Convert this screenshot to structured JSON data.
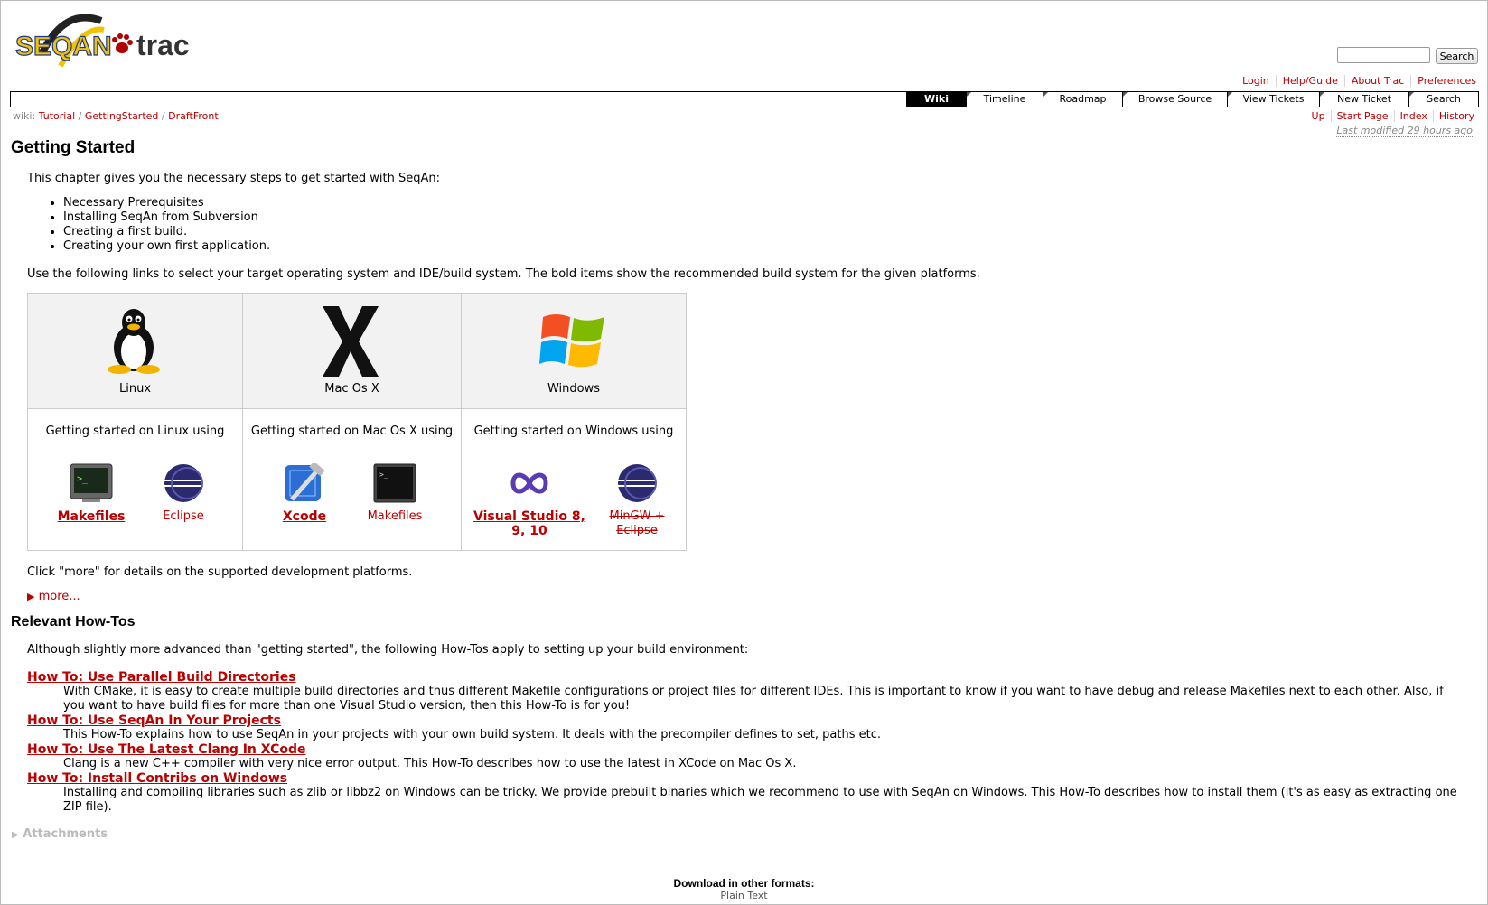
{
  "logo": {
    "text_left": "SEQAN",
    "text_right": "trac"
  },
  "search": {
    "placeholder": "",
    "button": "Search"
  },
  "metanav": [
    "Login",
    "Help/Guide",
    "About Trac",
    "Preferences"
  ],
  "mainnav": [
    {
      "label": "Wiki",
      "active": true
    },
    {
      "label": "Timeline"
    },
    {
      "label": "Roadmap"
    },
    {
      "label": "Browse Source"
    },
    {
      "label": "View Tickets"
    },
    {
      "label": "New Ticket"
    },
    {
      "label": "Search"
    }
  ],
  "pagepath": {
    "prefix": "wiki:",
    "crumbs": [
      "Tutorial",
      "GettingStarted",
      "DraftFront"
    ]
  },
  "ctxtnav": [
    "Up",
    "Start Page",
    "Index",
    "History"
  ],
  "last_modified": {
    "prefix": "Last modified ",
    "age": "29 hours ago"
  },
  "content": {
    "title": "Getting Started",
    "intro": "This chapter gives you the necessary steps to get started with SeqAn:",
    "bullets": [
      "Necessary Prerequisites",
      "Installing SeqAn from Subversion",
      "Creating a first build.",
      "Creating your own first application."
    ],
    "select_text": "Use the following links to select your target operating system and IDE/build system. The bold items show the recommended build system for the given platforms.",
    "platforms": [
      {
        "name": "Linux",
        "using": "Getting started on Linux using",
        "tools": [
          {
            "label": "Makefiles",
            "bold": true,
            "icon": "terminal-icon"
          },
          {
            "label": "Eclipse",
            "icon": "eclipse-icon"
          }
        ]
      },
      {
        "name": "Mac Os X",
        "using": "Getting started on Mac Os X using",
        "tools": [
          {
            "label": "Xcode",
            "bold": true,
            "icon": "xcode-icon"
          },
          {
            "label": "Makefiles",
            "icon": "terminal-icon"
          }
        ]
      },
      {
        "name": "Windows",
        "using": "Getting started on Windows using",
        "tools": [
          {
            "label": "Visual Studio 8, 9, 10",
            "bold": true,
            "icon": "visual-studio-icon"
          },
          {
            "label": "MinGW + Eclipse",
            "strike": true,
            "icon": "eclipse-icon"
          }
        ]
      }
    ],
    "more_note": "Click \"more\" for details on the supported development platforms.",
    "more_link": "more...",
    "howtos_title": "Relevant How-Tos",
    "howtos_intro": "Although slightly more advanced than \"getting started\", the following How-Tos apply to setting up your build environment:",
    "howtos": [
      {
        "title": "How To: Use Parallel Build Directories",
        "desc": "With CMake, it is easy to create multiple build directories and thus different Makefile configurations or project files for different IDEs. This is important to know if you want to have debug and release Makefiles next to each other. Also, if you want to have build files for more than one Visual Studio version, then this How-To is for you!"
      },
      {
        "title": "How To: Use SeqAn In Your Projects",
        "desc": "This How-To explains how to use SeqAn in your projects with your own build system. It deals with the precompiler defines to set, paths etc."
      },
      {
        "title": "How To: Use The Latest Clang In XCode",
        "desc": "Clang is a new C++ compiler with very nice error output. This How-To describes how to use the latest in XCode on Mac Os X."
      },
      {
        "title": "How To: Install Contribs on Windows",
        "desc": "Installing and compiling libraries such as zlib or libbz2 on Windows can be tricky. We provide prebuilt binaries which we recommend to use with SeqAn on Windows. This How-To describes how to install them (it's as easy as extracting one ZIP file)."
      }
    ],
    "attachments": "Attachments"
  },
  "footer": {
    "download_label": "Download in other formats:",
    "plain_text": "Plain Text"
  },
  "colors": {
    "link": "#bb0000",
    "header_bg": "#f2f2f2",
    "logo_yellow": "#f2c200",
    "logo_blue": "#1c3a8c",
    "trac_red": "#b00000"
  }
}
